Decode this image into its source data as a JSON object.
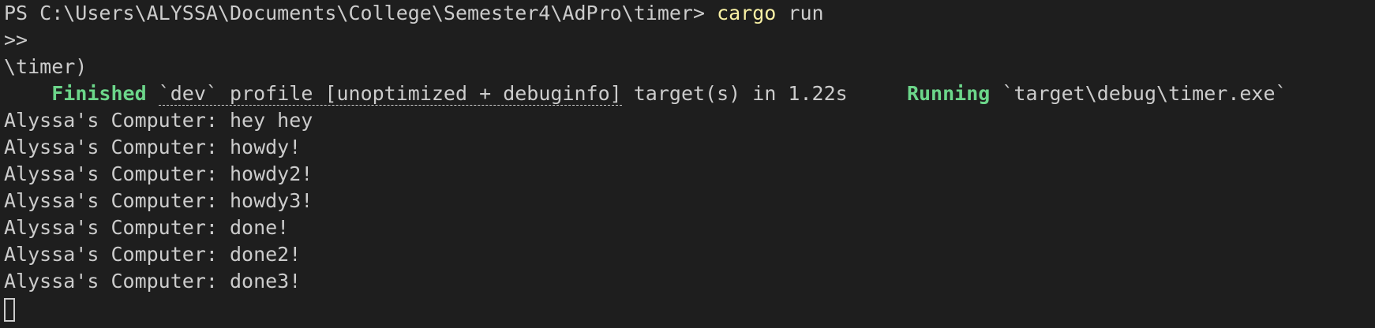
{
  "prompt_line": {
    "prompt": "PS C:\\Users\\ALYSSA\\Documents\\College\\Semester4\\AdPro\\timer> ",
    "command": "cargo",
    "args": " run"
  },
  "continuation_line": ">>",
  "partial_line": "\\timer)",
  "finished_line": {
    "indent": "    ",
    "finished_word": "Finished",
    "space": " ",
    "profile_text": "`dev` profile [unoptimized + debuginfo]",
    "details": " target(s) in 1.22s     ",
    "running_word": "Running",
    "running_target": " `target\\debug\\timer.exe`"
  },
  "output_lines": [
    "Alyssa's Computer: hey hey",
    "Alyssa's Computer: howdy!",
    "Alyssa's Computer: howdy2!",
    "Alyssa's Computer: howdy3!",
    "Alyssa's Computer: done!",
    "Alyssa's Computer: done2!",
    "Alyssa's Computer: done3!"
  ],
  "colors": {
    "background": "#1e1e1e",
    "text": "#cccccc",
    "command": "#f9f1a5",
    "status": "#6cd68a"
  }
}
